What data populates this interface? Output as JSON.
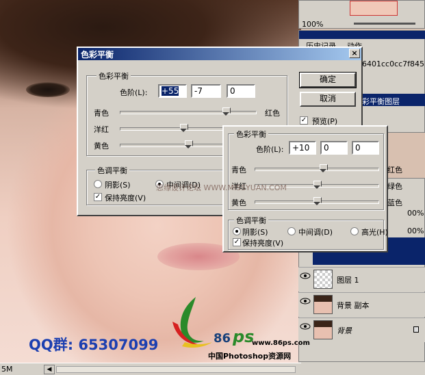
{
  "main_dialog": {
    "title": "色彩平衡",
    "close": "×",
    "color_balance_group": "色彩平衡",
    "levels_label": "色阶(L):",
    "level_values": [
      "+55",
      "-7",
      "0"
    ],
    "slider_left": [
      "青色",
      "洋红",
      "黄色"
    ],
    "slider_right": [
      "红色",
      "绿色",
      "蓝色"
    ],
    "slider_levels": [
      55,
      -7,
      0
    ],
    "tone_group": "色调平衡",
    "tone_options": [
      "阴影(S)",
      "中间调(D)"
    ],
    "selected_tone": "中间调(D)",
    "preserve_luminosity": "保持亮度(V)",
    "ok": "确定",
    "cancel": "取消",
    "preview": "预览(P)"
  },
  "second_dialog": {
    "color_balance_group": "色彩平衡",
    "levels_label": "色阶(L):",
    "level_values": [
      "+10",
      "0",
      "0"
    ],
    "slider_left": [
      "青色",
      "洋红",
      "黄色"
    ],
    "slider_right": [
      "红色",
      "绿色",
      "蓝色"
    ],
    "slider_levels": [
      10,
      0,
      0
    ],
    "tone_group": "色调平衡",
    "tone_options": [
      "阴影(S)",
      "中间调(D)",
      "高光(H)"
    ],
    "selected_tone": "阴影(S)",
    "preserve_luminosity": "保持亮度(V)"
  },
  "right_panel": {
    "zoom": "100%",
    "history_tab": "历史记录",
    "actions_tab": "动作",
    "doc_name": "6401cc0cc7f845...",
    "active_step": "彩平衡图层",
    "opacity_a": "00%",
    "opacity_b": "00%",
    "layers": [
      "图层 1",
      "背景 副本",
      "背景"
    ]
  },
  "watermark": "思缘设计论坛 WWW.MISSYUAN.COM",
  "qq_text": "QQ群: 65307099",
  "logo": {
    "num": "86",
    "ps": "ps",
    "site": "www.86ps.com",
    "tagline": "中国Photoshop资源网"
  },
  "status": {
    "size": "5M"
  },
  "colors": {
    "titlebar": "#0a246a",
    "dialog_bg": "#d4d0c8",
    "qq_blue": "#1c3fb0"
  }
}
